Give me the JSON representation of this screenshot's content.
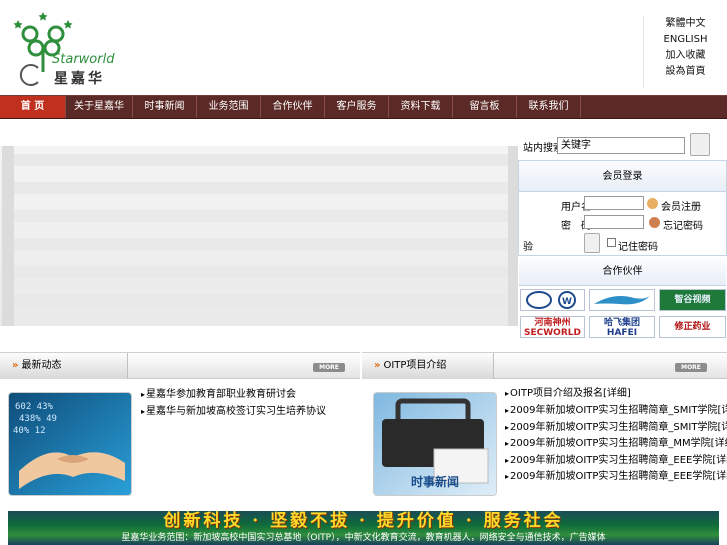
{
  "brand": {
    "en": "Starworld",
    "zh": "星嘉华",
    "accent": "#2f8f3c"
  },
  "lang_links": [
    "繁體中文",
    "ENGLISH",
    "加入收藏",
    "設為首頁"
  ],
  "nav": {
    "bg": "#5b2a26",
    "active_bg": "#c0301e",
    "items": [
      "首 页",
      "关于星嘉华",
      "时事新闻",
      "业务范围",
      "合作伙伴",
      "客户服务",
      "资料下载",
      "留言板",
      "联系我们"
    ]
  },
  "search": {
    "label": "站内搜索",
    "value": "关键字"
  },
  "login": {
    "title": "会员登录",
    "user_label": "用户名：",
    "pass_label": "密　码：",
    "register": "会员注册",
    "forgot": "忘记密码",
    "remember": "记住密码",
    "code_prefix": "验"
  },
  "partners": {
    "title": "合作伙伴",
    "logos": [
      "FAW / VW",
      "hawk-logo",
      "智谷视频",
      "河南神州 SECWORLD",
      "哈飞集团 HAFEI GROUP",
      "修正药业"
    ]
  },
  "news": {
    "title": "最新动态",
    "more": "MORE",
    "items": [
      "星嘉华参加教育部职业教育研讨会",
      "星嘉华与新加坡高校签订实习生培养协议"
    ],
    "thumb_icon": "handshake-icon"
  },
  "oitp": {
    "title": "OITP项目介绍",
    "more": "MORE",
    "thumb_caption": "时事新闻",
    "items": [
      "OITP项目介绍及报名[详细]",
      "2009年新加坡OITP实习生招聘简章_SMIT学院[详细]",
      "2009年新加坡OITP实习生招聘简章_SMIT学院[详细]",
      "2009年新加坡OITP实习生招聘简章_MM学院[详细]",
      "2009年新加坡OITP实习生招聘简章_EEE学院[详细]",
      "2009年新加坡OITP实习生招聘简章_EEE学院[详细]"
    ]
  },
  "footer": {
    "slogan": "创新科技 · 坚毅不拔 · 提升价值 · 服务社会",
    "text": "星嘉华业务范围：新加坡高校中国实习总基地（OITP），中新文化教育交流，教育机器人，网络安全与通信技术，广告媒体"
  }
}
